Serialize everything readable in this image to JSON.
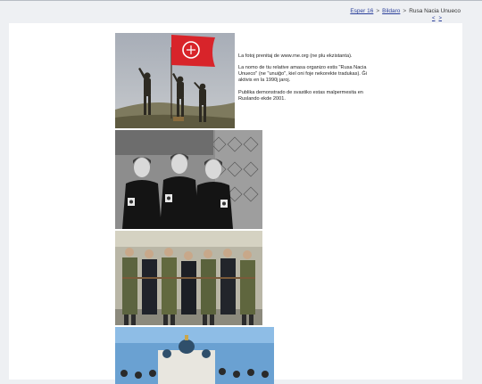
{
  "nav": {
    "breadcrumb": [
      {
        "label": "Esper 16",
        "link": true
      },
      {
        "label": "Bildaro",
        "link": true
      },
      {
        "label": "Rusa Nacia Unueco",
        "link": false
      }
    ],
    "separator": ">",
    "prev_label": "<",
    "next_label": ">"
  },
  "caption": {
    "lines": [
      "La fotoj prenitaj de www.rne.org (ne plu ekzistanta).",
      "La nomo de tiu relative amasa organizo estis \"Rusa Nacia Unueco\" (ne \"unuiĝo\", kiel oni foje nekorekte tradukas). Ĝi aktivis en la 1990j jaroj.",
      "Publika demonstrado de svastiko estas malpermesita en Ruslando ekde 2001."
    ]
  },
  "photos": [
    {
      "name": "flag-raising-photo",
      "alt": "Men raising a red flag with emblem on a hill"
    },
    {
      "name": "women-in-uniform-photo",
      "alt": "Women in black uniforms with armbands"
    },
    {
      "name": "uniformed-formation-photo",
      "alt": "Men in camouflage and black uniforms standing in formation"
    },
    {
      "name": "church-gathering-photo",
      "alt": "Gathering in front of a church with domes"
    }
  ],
  "colors": {
    "link": "#2a3f9a",
    "page_bg": "#eef0f3",
    "card_bg": "#ffffff",
    "flag_red": "#d8242a"
  }
}
